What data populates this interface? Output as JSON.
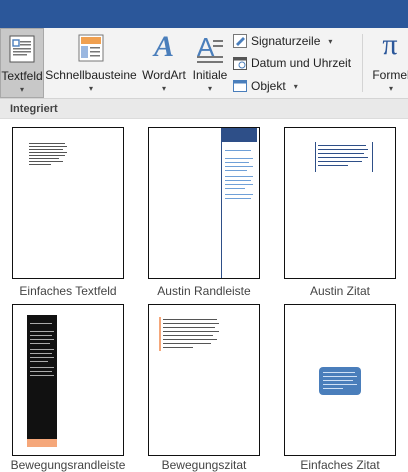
{
  "ribbon": {
    "textfeld": {
      "label": "Textfeld",
      "icon": "textbox-icon"
    },
    "schnellbausteine": {
      "label": "Schnellbausteine",
      "icon": "quickparts-icon"
    },
    "wordart": {
      "label": "WordArt",
      "glyph": "A",
      "icon": "wordart-icon"
    },
    "initiale": {
      "label": "Initiale",
      "glyph": "A",
      "icon": "dropcap-icon"
    },
    "signaturzeile": {
      "label": "Signaturzeile",
      "icon": "signature-line-icon"
    },
    "datum": {
      "label": "Datum und Uhrzeit",
      "icon": "calendar-icon"
    },
    "objekt": {
      "label": "Objekt",
      "icon": "object-icon"
    },
    "formel": {
      "label": "Formel",
      "glyph": "π",
      "icon": "equation-pi-icon"
    },
    "caret": "▾"
  },
  "section_title": "Integriert",
  "gallery": [
    {
      "caption": "Einfaches Textfeld"
    },
    {
      "caption": "Austin Randleiste"
    },
    {
      "caption": "Austin Zitat"
    },
    {
      "caption": "Bewegungsrandleiste"
    },
    {
      "caption": "Bewegungszitat"
    },
    {
      "caption": "Einfaches Zitat"
    }
  ],
  "colors": {
    "title_bar": "#2b579a",
    "accent_blue": "#4a7ebb",
    "austin_blue": "#2e4f88",
    "orange": "#f5a77a"
  }
}
